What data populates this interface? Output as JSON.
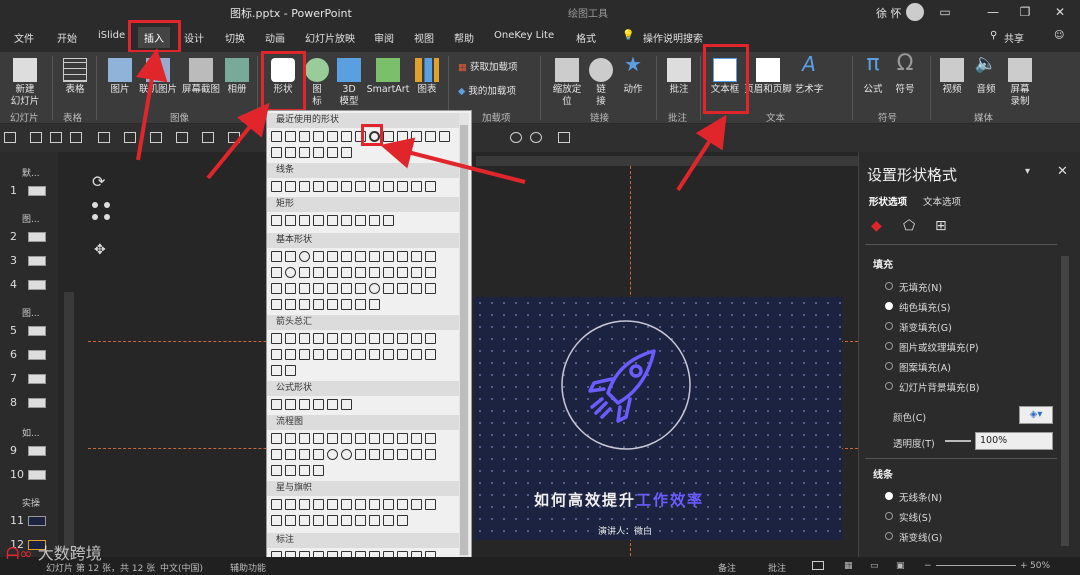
{
  "window": {
    "title": "图标.pptx - PowerPoint",
    "context_tab_group": "绘图工具",
    "user": "徐 怀"
  },
  "tabs": [
    "文件",
    "开始",
    "iSlide",
    "插入",
    "设计",
    "切换",
    "动画",
    "幻灯片放映",
    "审阅",
    "视图",
    "帮助",
    "OneKey Lite",
    "格式"
  ],
  "active_tab": "插入",
  "search_hint": "操作说明搜索",
  "share_label": "共享",
  "ribbon": {
    "new_slide": "新建\n幻灯片",
    "table": "表格",
    "picture": "图片",
    "online_picture": "联机图片",
    "screenshot": "屏幕截图",
    "album": "相册",
    "shapes": "形状",
    "icons": "图\n标",
    "model3d": "3D\n模型",
    "smartart": "SmartArt",
    "chart": "图表",
    "get_addins": "获取加载项",
    "my_addins": "我的加载项",
    "zoom": "缩放定\n位",
    "link": "链\n接",
    "action": "动作",
    "comment": "批注",
    "textbox": "文本框",
    "header_footer": "页眉和页脚",
    "wordart": "艺术字",
    "equation": "公式",
    "symbol": "符号",
    "video": "视频",
    "audio": "音频",
    "screen_record": "屏幕\n录制",
    "groups": {
      "slides": "幻灯片",
      "tables": "表格",
      "images": "图像",
      "addins": "加载项",
      "links": "链接",
      "comments": "批注",
      "text": "文本",
      "symbols": "符号",
      "media": "媒体"
    }
  },
  "shape_menu": {
    "recent": "最近使用的形状",
    "lines": "线条",
    "rectangles": "矩形",
    "basic": "基本形状",
    "arrows": "箭头总汇",
    "equation": "公式形状",
    "flowchart": "流程图",
    "stars": "星与旗帜",
    "callouts": "标注"
  },
  "slides_pane": {
    "sections": [
      {
        "label": "默..."
      },
      {
        "label": "图..."
      },
      {
        "label": "图..."
      },
      {
        "label": "如..."
      },
      {
        "label": "实操"
      }
    ],
    "numbers": [
      "1",
      "2",
      "3",
      "4",
      "5",
      "6",
      "7",
      "8",
      "9",
      "10",
      "11",
      "12"
    ]
  },
  "slide": {
    "title_part1": "如何高效提升",
    "title_part2": "工作效率",
    "presenter": "演讲人：微白",
    "accent": "#6a5cff"
  },
  "format_pane": {
    "title": "设置形状格式",
    "tab_shape": "形状选项",
    "tab_text": "文本选项",
    "fill_section": "填充",
    "fill_options": [
      "无填充(N)",
      "纯色填充(S)",
      "渐变填充(G)",
      "图片或纹理填充(P)",
      "图案填充(A)",
      "幻灯片背景填充(B)"
    ],
    "selected_fill": "纯色填充(S)",
    "color_label": "颜色(C)",
    "transparency_label": "透明度(T)",
    "transparency_value": "100%",
    "line_section": "线条",
    "line_options": [
      "无线条(N)",
      "实线(S)",
      "渐变线(G)"
    ],
    "selected_line": "无线条(N)"
  },
  "status": {
    "slide_info": "幻灯片 第 12 张，共 12 张",
    "language": "中文(中国)",
    "accessibility": "辅助功能",
    "notes": "备注",
    "comments": "批注",
    "zoom": "50%"
  },
  "watermark": "大数跨境",
  "colors": {
    "red_highlight": "#e0262b",
    "slide_bg": "#1c2340"
  }
}
